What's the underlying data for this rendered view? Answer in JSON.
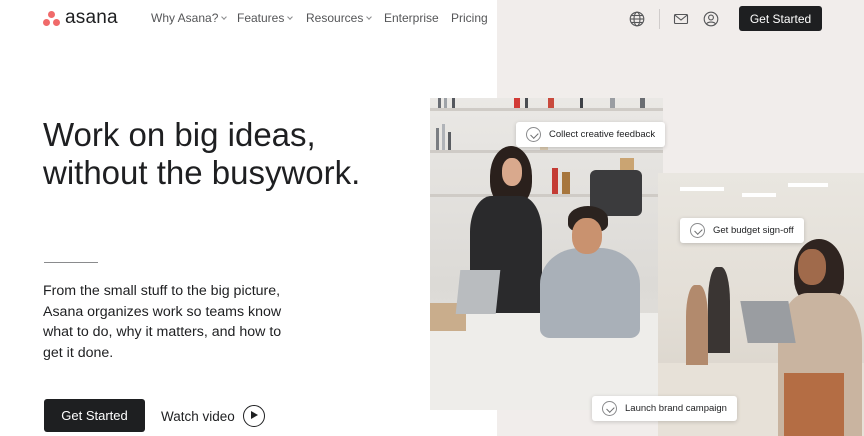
{
  "brand": {
    "name": "asana",
    "accent": "#f06a6a",
    "dark": "#1e1f21",
    "panel_bg": "#f1edeb"
  },
  "nav": {
    "items": [
      {
        "label": "Why Asana?",
        "has_dropdown": true
      },
      {
        "label": "Features",
        "has_dropdown": true
      },
      {
        "label": "Resources",
        "has_dropdown": true
      },
      {
        "label": "Enterprise",
        "has_dropdown": false
      },
      {
        "label": "Pricing",
        "has_dropdown": false
      }
    ],
    "icons": [
      "globe-icon",
      "mail-icon",
      "user-account-icon"
    ],
    "cta_label": "Get Started"
  },
  "hero": {
    "title_lines": [
      "Work on big ideas,",
      "without the busywork."
    ],
    "subtitle_lines": [
      "From the small stuff to the big picture,",
      "Asana organizes work so teams know",
      "what to do, why it matters, and how to",
      "get it done."
    ],
    "cta_label": "Get Started",
    "video_label": "Watch video",
    "video_icon": "play-circle-icon"
  },
  "tasks": [
    {
      "label": "Collect creative feedback",
      "icon": "check-circle-icon"
    },
    {
      "label": "Get budget sign-off",
      "icon": "check-circle-icon"
    },
    {
      "label": "Launch brand campaign",
      "icon": "check-circle-icon"
    }
  ]
}
